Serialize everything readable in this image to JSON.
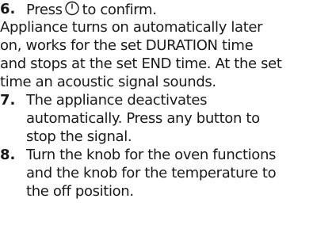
{
  "steps": [
    {
      "number": "6.",
      "lines": [
        "Press",
        "to confirm."
      ],
      "icon": "power-icon"
    },
    {
      "number": "",
      "lines": [
        "Appliance turns on automatically later",
        "on, works for the set DURATION time",
        "and stops at the set END time. At the set",
        "time an acoustic signal sounds."
      ]
    },
    {
      "number": "7.",
      "lines": [
        "The appliance deactivates",
        "automatically. Press any button to",
        "stop the signal."
      ]
    },
    {
      "number": "8.",
      "lines": [
        "Turn the knob for the oven functions",
        "and the knob for the temperature to",
        "the off position."
      ]
    }
  ]
}
